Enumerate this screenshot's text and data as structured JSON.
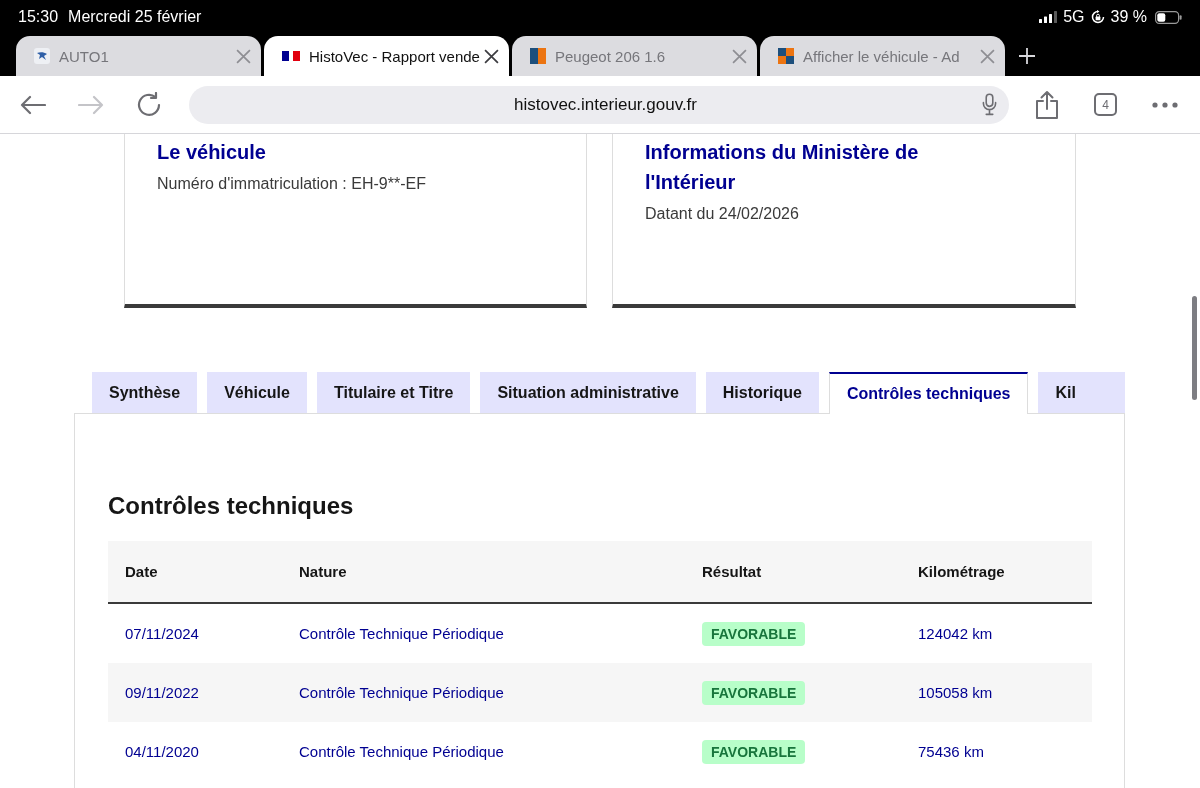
{
  "status_bar": {
    "time": "15:30",
    "date": "Mercredi 25 février",
    "network": "5G",
    "battery": "39 %"
  },
  "browser_tabs": [
    {
      "title": "AUTO1",
      "selected": false
    },
    {
      "title": "HistoVec - Rapport vende",
      "selected": true
    },
    {
      "title": "Peugeot 206 1.6",
      "selected": false
    },
    {
      "title": "Afficher le véhicule - Ad",
      "selected": false
    }
  ],
  "toolbar": {
    "nav_buttons": [
      {
        "kind": "back",
        "disabled": false
      },
      {
        "kind": "forward",
        "disabled": true
      },
      {
        "kind": "reload",
        "disabled": false
      }
    ],
    "url": "histovec.interieur.gouv.fr",
    "tab_count": "4"
  },
  "cards": [
    {
      "title": "Le véhicule",
      "text": "Numéro d'immatriculation : EH-9**-EF"
    },
    {
      "title": "Informations du Ministère de l'Intérieur",
      "text": "Datant du 24/02/2026"
    }
  ],
  "page_tabs": [
    {
      "label": "Synthèse",
      "selected": false
    },
    {
      "label": "Véhicule",
      "selected": false
    },
    {
      "label": "Titulaire et Titre",
      "selected": false
    },
    {
      "label": "Situation administrative",
      "selected": false
    },
    {
      "label": "Historique",
      "selected": false
    },
    {
      "label": "Contrôles techniques",
      "selected": true
    },
    {
      "label": "Kil",
      "selected": false
    }
  ],
  "section": {
    "title": "Contrôles techniques",
    "table": {
      "columns": [
        "Date",
        "Nature",
        "Résultat",
        "Kilométrage"
      ],
      "rows": [
        {
          "date": "07/11/2024",
          "nature": "Contrôle Technique Périodique",
          "result": {
            "label": "FAVORABLE",
            "kind": "success"
          },
          "mileage": "124042 km"
        },
        {
          "date": "09/11/2022",
          "nature": "Contrôle Technique Périodique",
          "result": {
            "label": "FAVORABLE",
            "kind": "success"
          },
          "mileage": "105058 km"
        },
        {
          "date": "04/11/2020",
          "nature": "Contrôle Technique Périodique",
          "result": {
            "label": "FAVORABLE",
            "kind": "success"
          },
          "mileage": "75436 km"
        }
      ]
    }
  }
}
